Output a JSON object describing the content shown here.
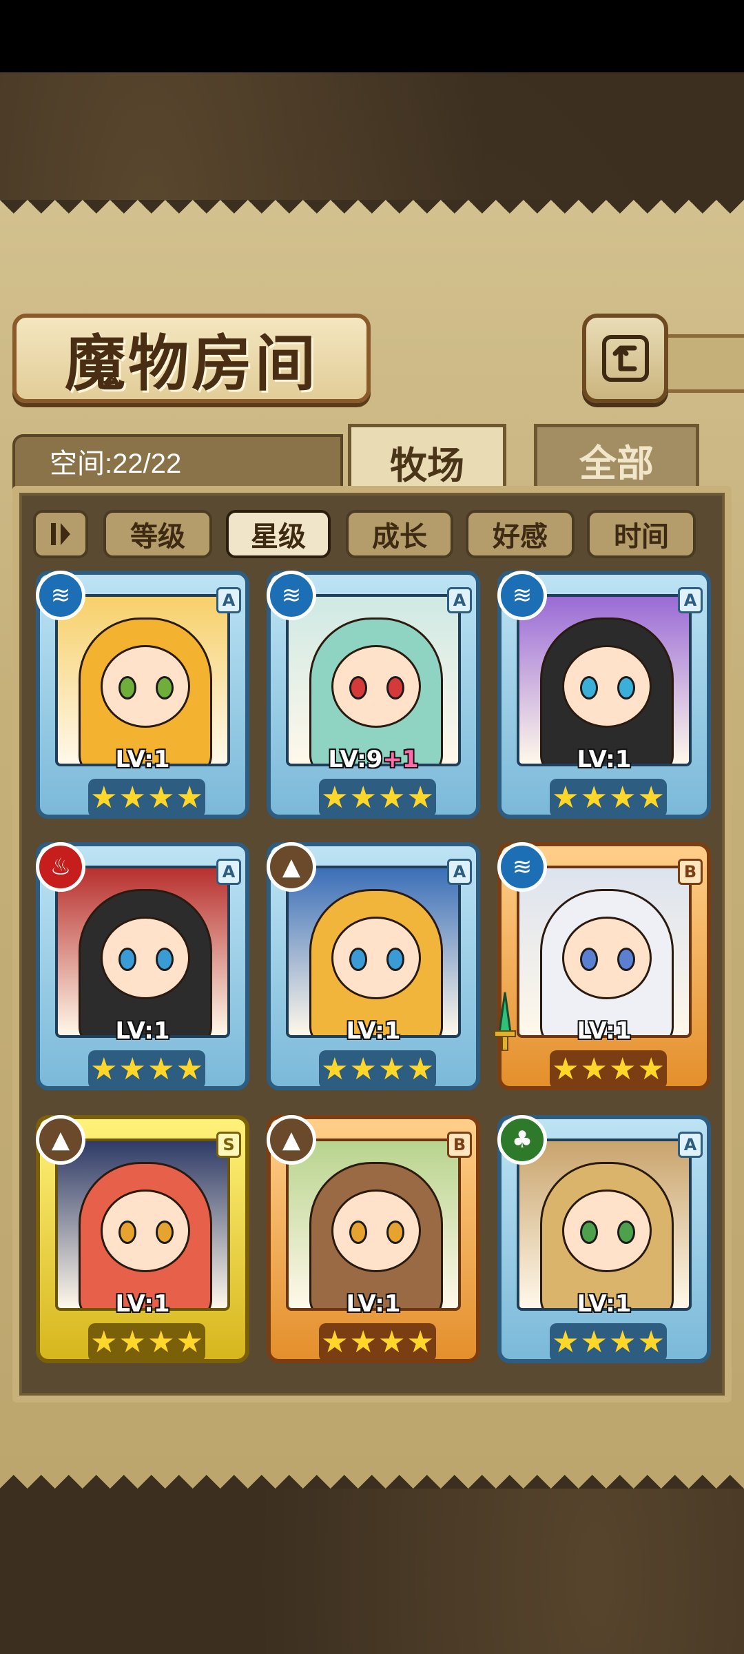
{
  "header": {
    "title": "魔物房间"
  },
  "space": {
    "label": "空间:22/22"
  },
  "tabs": [
    {
      "label": "牧场",
      "active": true
    },
    {
      "label": "全部",
      "active": false
    }
  ],
  "sort": {
    "buttons": [
      {
        "label": "等级",
        "active": false
      },
      {
        "label": "星级",
        "active": true
      },
      {
        "label": "成长",
        "active": false
      },
      {
        "label": "好感",
        "active": false
      },
      {
        "label": "时间",
        "active": false
      }
    ]
  },
  "colors": {
    "accent": "#2d5d80",
    "panel": "#c5b07a",
    "star": "#ffd72a"
  },
  "monsters": [
    {
      "level": "LV:1",
      "bonus": "",
      "rank": "A",
      "element": "water",
      "stars": 4,
      "frame": "blue",
      "palette": {
        "hair": "#f3b230",
        "bg": "#f7d06a",
        "eye": "#6fae3b"
      }
    },
    {
      "level": "LV:9",
      "bonus": "+1",
      "rank": "A",
      "element": "water",
      "stars": 4,
      "frame": "blue",
      "palette": {
        "hair": "#8fd3c2",
        "bg": "#cfe9e4",
        "eye": "#d53a3a"
      }
    },
    {
      "level": "LV:1",
      "bonus": "",
      "rank": "A",
      "element": "water",
      "stars": 4,
      "frame": "blue",
      "palette": {
        "hair": "#2b2b2b",
        "bg": "#9a6bd6",
        "eye": "#3ab0d8"
      }
    },
    {
      "level": "LV:1",
      "bonus": "",
      "rank": "A",
      "element": "fire",
      "stars": 4,
      "frame": "blue",
      "palette": {
        "hair": "#2c2c2c",
        "bg": "#b8302e",
        "eye": "#3a9bd5"
      }
    },
    {
      "level": "LV:1",
      "bonus": "",
      "rank": "A",
      "element": "earth",
      "stars": 4,
      "frame": "blue",
      "palette": {
        "hair": "#f0b53a",
        "bg": "#3b6fb8",
        "eye": "#3a9bd5"
      }
    },
    {
      "level": "LV:1",
      "bonus": "",
      "rank": "B",
      "element": "water",
      "stars": 4,
      "frame": "orange",
      "palette": {
        "hair": "#eef0f5",
        "bg": "#dde3ee",
        "eye": "#5b7fd1"
      }
    },
    {
      "level": "LV:1",
      "bonus": "",
      "rank": "S",
      "element": "earth",
      "stars": 4,
      "frame": "gold",
      "palette": {
        "hair": "#e6604a",
        "bg": "#2f3b67",
        "eye": "#e6a330"
      }
    },
    {
      "level": "LV:1",
      "bonus": "",
      "rank": "B",
      "element": "earth",
      "stars": 4,
      "frame": "orange",
      "palette": {
        "hair": "#9a6a45",
        "bg": "#b8d48e",
        "eye": "#e6a330"
      }
    },
    {
      "level": "LV:1",
      "bonus": "",
      "rank": "A",
      "element": "wood",
      "stars": 4,
      "frame": "blue",
      "palette": {
        "hair": "#d9b46a",
        "bg": "#c9a46d",
        "eye": "#4ea14b"
      }
    }
  ]
}
